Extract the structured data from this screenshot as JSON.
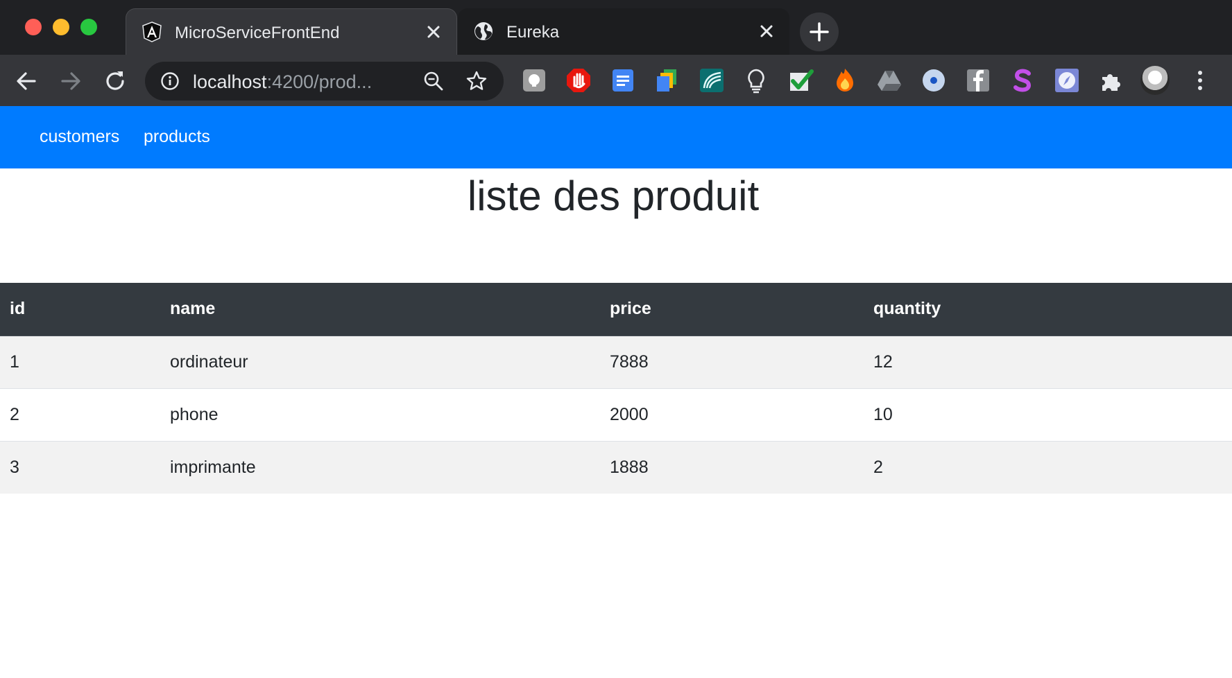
{
  "browser": {
    "tabs": [
      {
        "title": "MicroServiceFrontEnd",
        "icon": "angular-icon",
        "active": true
      },
      {
        "title": "Eureka",
        "icon": "globe-icon",
        "active": false
      }
    ],
    "url_host": "localhost",
    "url_rest": ":4200/prod...",
    "extensions": [
      "gray-bubble-extension-icon",
      "adblock-hand-extension-icon",
      "google-docs-extension-icon",
      "file-stack-extension-icon",
      "teal-wave-extension-icon",
      "lightbulb-extension-icon",
      "green-check-extension-icon",
      "fire-extension-icon",
      "drive-extension-icon",
      "blue-circle-extension-icon",
      "facebook-extension-icon",
      "purple-s-extension-icon",
      "compass-extension-icon",
      "puzzle-extensions-icon"
    ]
  },
  "navbar": {
    "links": [
      "customers",
      "products"
    ],
    "color": "#007bff"
  },
  "page": {
    "title": "liste des produit"
  },
  "table": {
    "columns": [
      "id",
      "name",
      "price",
      "quantity"
    ],
    "rows": [
      [
        "1",
        "ordinateur",
        "7888",
        "12"
      ],
      [
        "2",
        "phone",
        "2000",
        "10"
      ],
      [
        "3",
        "imprimante",
        "1888",
        "2"
      ]
    ]
  }
}
